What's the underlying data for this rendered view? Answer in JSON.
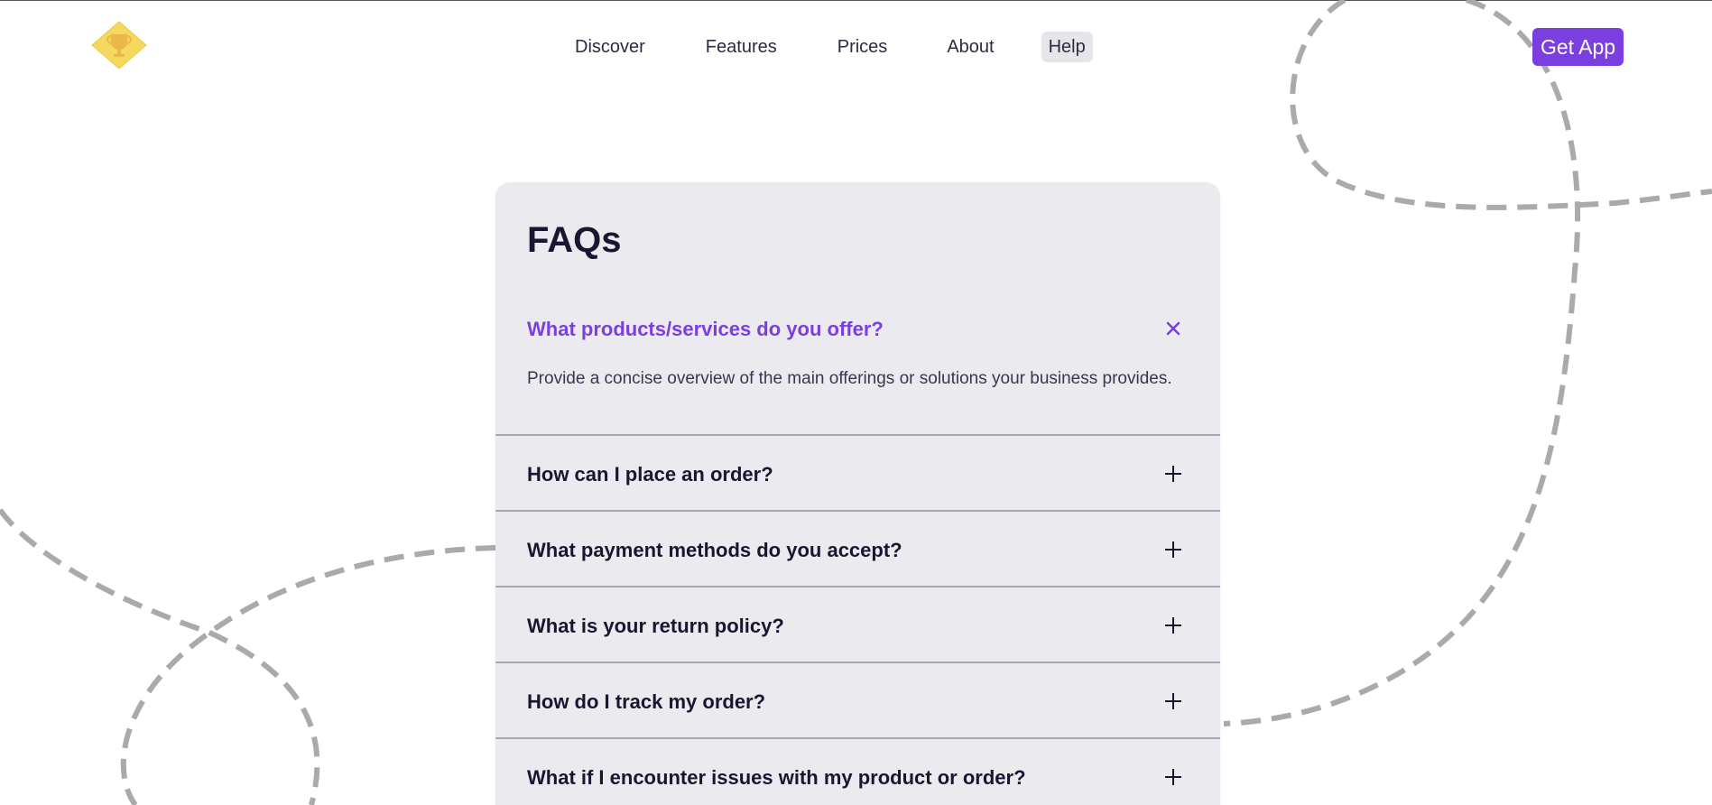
{
  "nav": {
    "logo_icon": "trophy-icon",
    "links": [
      "Discover",
      "Features",
      "Prices",
      "About",
      "Help"
    ],
    "active": "Help",
    "cta_label": "Get App"
  },
  "faq": {
    "title": "FAQs",
    "items": [
      {
        "question": "What products/services do you offer?",
        "answer": "Provide a concise overview of the main offerings or solutions your business provides.",
        "expanded": true,
        "toggle_icon": "close-icon"
      },
      {
        "question": "How can I place an order?",
        "expanded": false,
        "toggle_icon": "plus-icon"
      },
      {
        "question": "What payment methods do you accept?",
        "expanded": false,
        "toggle_icon": "plus-icon"
      },
      {
        "question": "What is your return policy?",
        "expanded": false,
        "toggle_icon": "plus-icon"
      },
      {
        "question": "How do I track my order?",
        "expanded": false,
        "toggle_icon": "plus-icon"
      },
      {
        "question": "What if I encounter issues with my product or order?",
        "expanded": false,
        "toggle_icon": "plus-icon"
      }
    ]
  },
  "colors": {
    "accent": "#7b3fe0",
    "card_bg": "#ebebef",
    "logo_yellow": "#f5d85e",
    "squiggle": "#aaaaaa"
  }
}
